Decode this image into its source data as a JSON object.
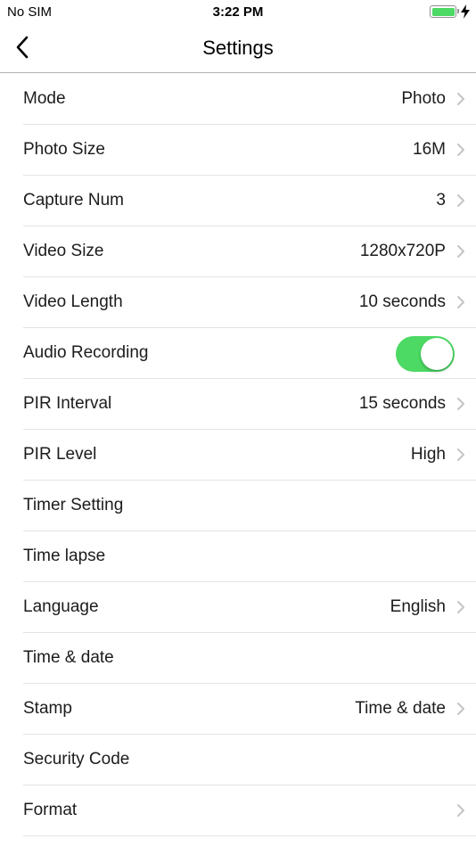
{
  "status_bar": {
    "carrier": "No SIM",
    "time": "3:22 PM",
    "battery_level": 1.0,
    "charging": true
  },
  "nav": {
    "title": "Settings",
    "back_icon": "chevron-left-icon"
  },
  "colors": {
    "toggle_on": "#4cd964",
    "battery_fill": "#4cd964",
    "chevron": "#c4c4c7",
    "separator": "#e3e3e6"
  },
  "settings": [
    {
      "label": "Mode",
      "value": "Photo",
      "chevron": true
    },
    {
      "label": "Photo Size",
      "value": "16M",
      "chevron": true
    },
    {
      "label": "Capture Num",
      "value": "3",
      "chevron": true
    },
    {
      "label": "Video Size",
      "value": "1280x720P",
      "chevron": true
    },
    {
      "label": "Video Length",
      "value": "10 seconds",
      "chevron": true
    },
    {
      "label": "Audio Recording",
      "toggle": true,
      "toggle_on": true
    },
    {
      "label": "PIR Interval",
      "value": "15 seconds",
      "chevron": true
    },
    {
      "label": "PIR Level",
      "value": "High",
      "chevron": true
    },
    {
      "label": "Timer Setting"
    },
    {
      "label": "Time lapse"
    },
    {
      "label": "Language",
      "value": "English",
      "chevron": true
    },
    {
      "label": "Time & date"
    },
    {
      "label": "Stamp",
      "value": "Time & date",
      "chevron": true
    },
    {
      "label": "Security Code"
    },
    {
      "label": "Format",
      "chevron": true
    }
  ]
}
